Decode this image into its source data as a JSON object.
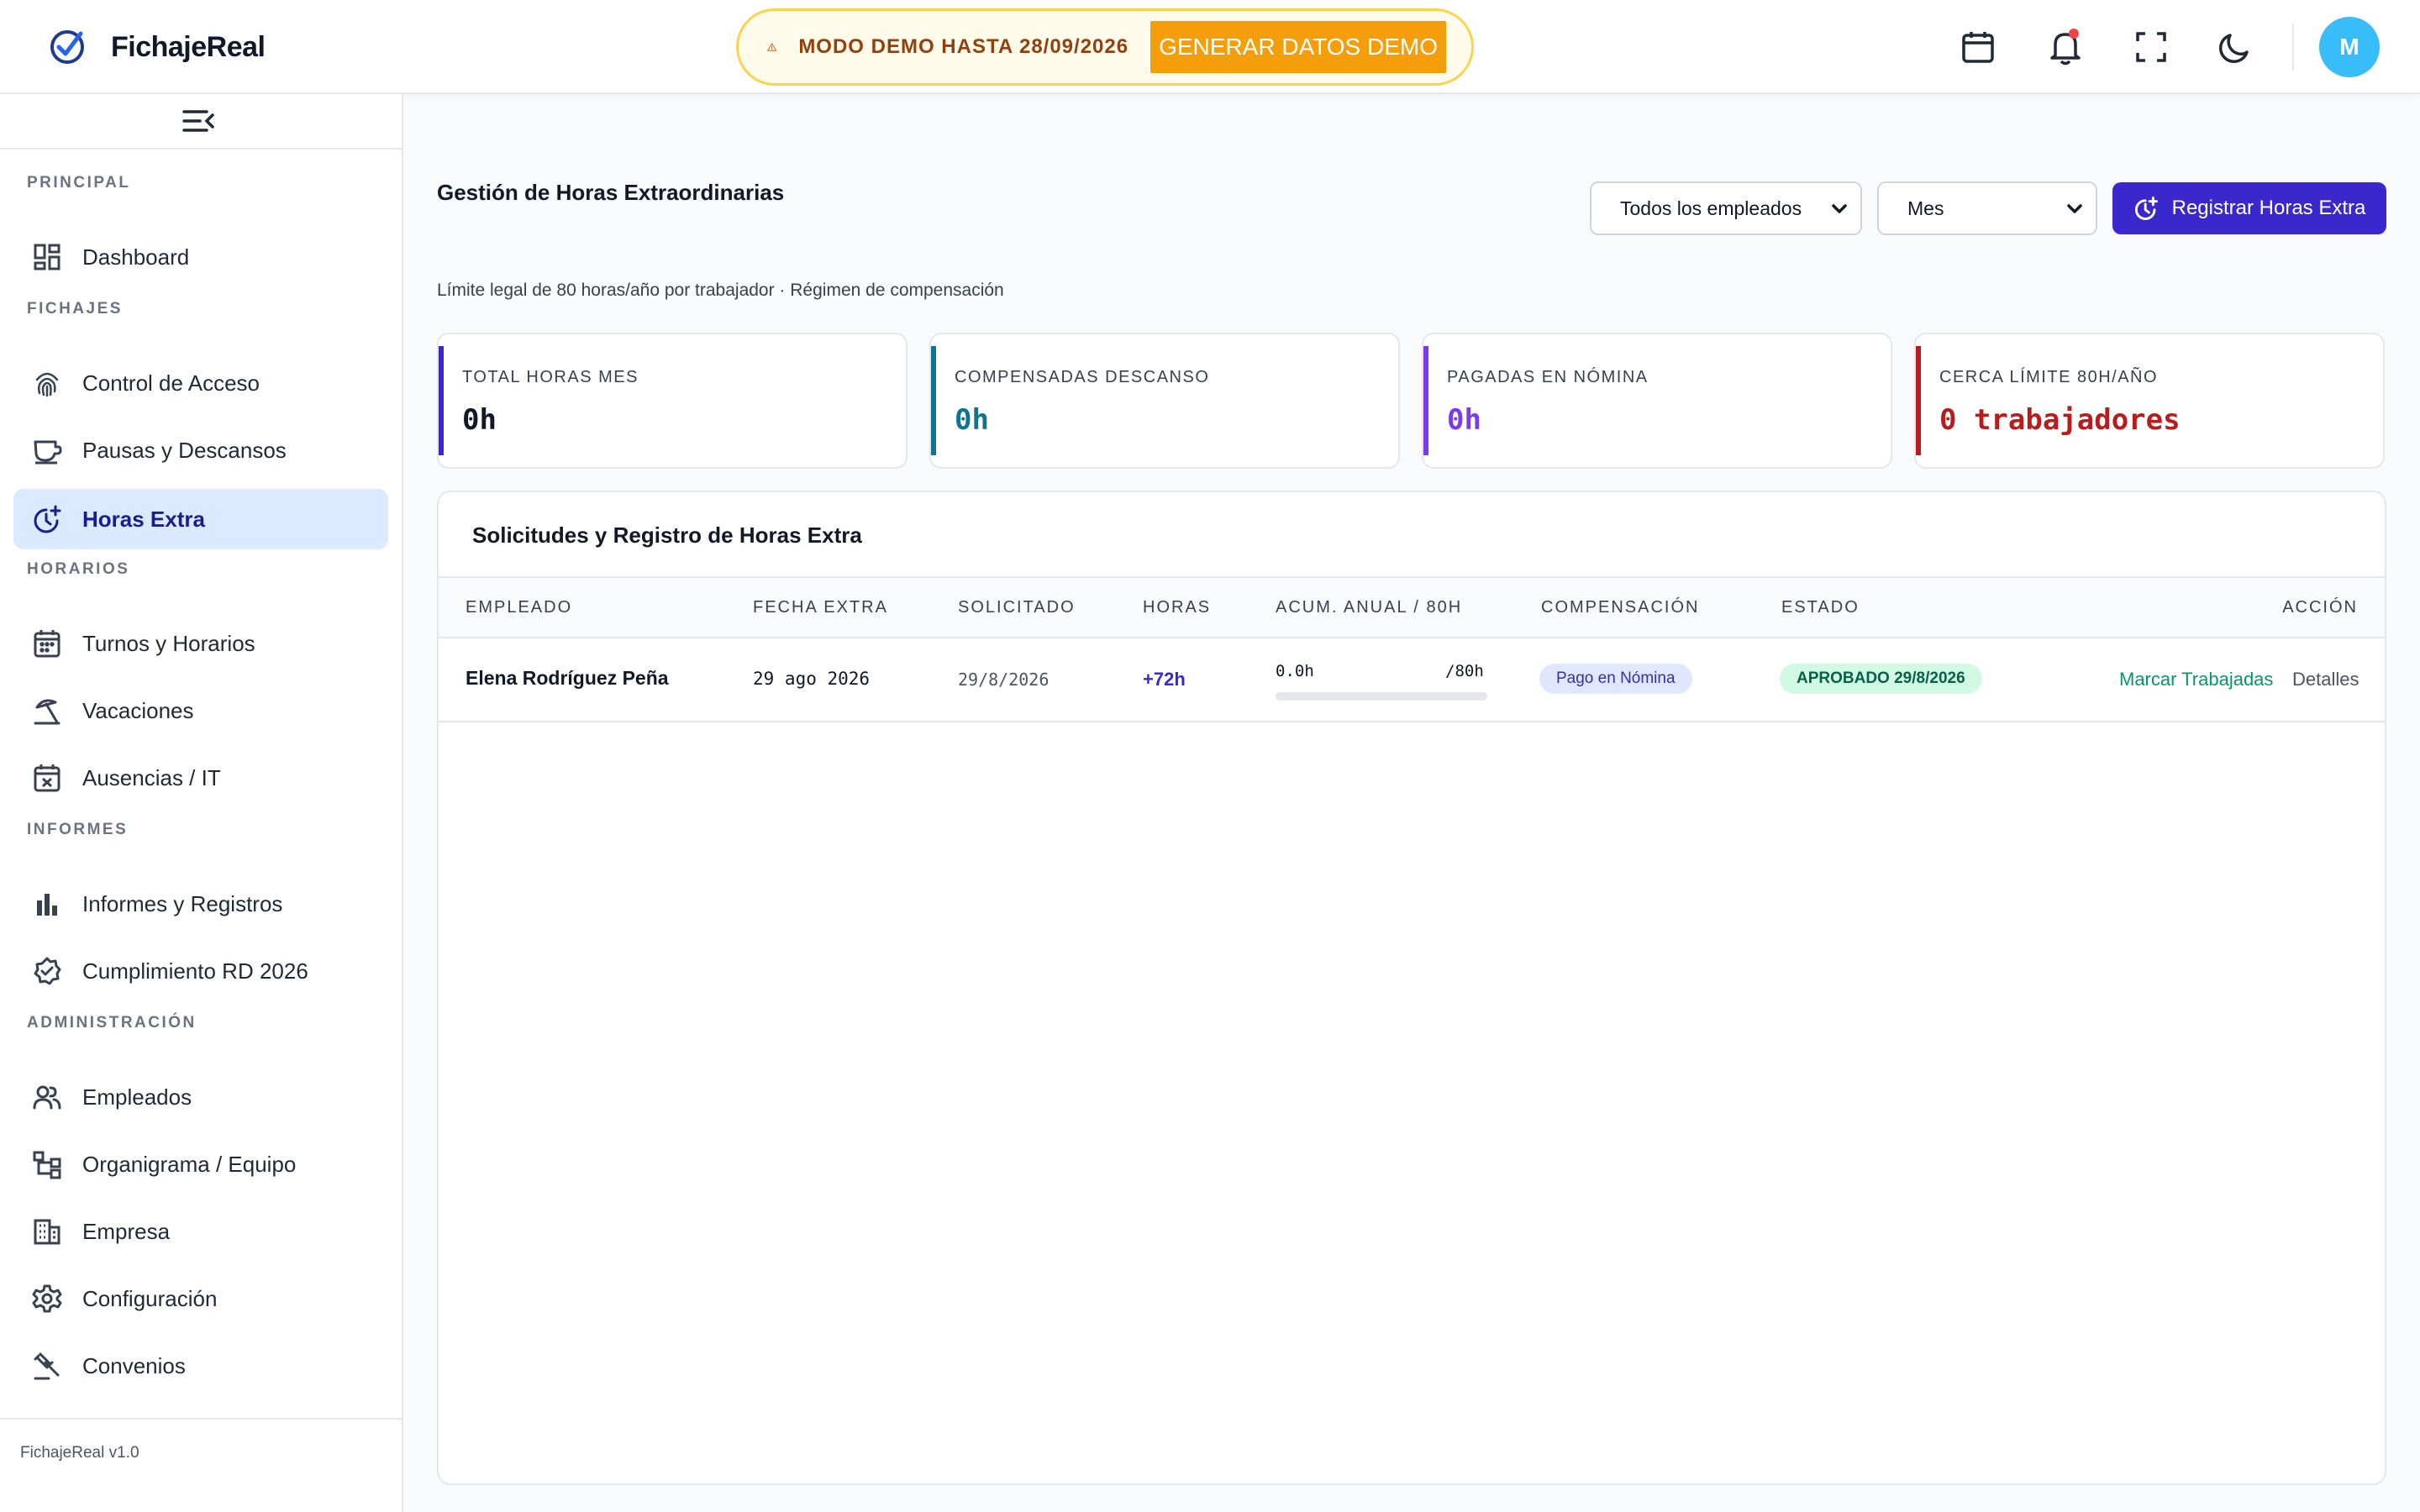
{
  "app": {
    "name": "FichajeReal",
    "version": "FichajeReal v1.0"
  },
  "banner": {
    "text": "MODO DEMO HASTA 28/09/2026",
    "button": "GENERAR DATOS DEMO"
  },
  "user": {
    "initial": "M"
  },
  "sidebar": {
    "sections": {
      "principal": "PRINCIPAL",
      "fichajes": "FICHAJES",
      "horarios": "HORARIOS",
      "informes": "INFORMES",
      "administracion": "ADMINISTRACIÓN"
    },
    "items": {
      "dashboard": "Dashboard",
      "control_acceso": "Control de Acceso",
      "pausas": "Pausas y Descansos",
      "horas_extra": "Horas Extra",
      "turnos": "Turnos y Horarios",
      "vacaciones": "Vacaciones",
      "ausencias": "Ausencias / IT",
      "informes": "Informes y Registros",
      "cumplimiento": "Cumplimiento RD 2026",
      "empleados": "Empleados",
      "organigrama": "Organigrama / Equipo",
      "empresa": "Empresa",
      "configuracion": "Configuración",
      "convenios": "Convenios"
    }
  },
  "page": {
    "title": "Gestión de Horas Extraordinarias",
    "subtitle": "Límite legal de 80 horas/año por trabajador · Régimen de compensación",
    "filters": {
      "employees": "Todos los empleados",
      "period": "Mes"
    },
    "primary_button": "Registrar Horas Extra"
  },
  "stats": [
    {
      "label": "TOTAL HORAS MES",
      "value": "0h",
      "color": "#111827",
      "accent": "#3b28cc"
    },
    {
      "label": "COMPENSADAS DESCANSO",
      "value": "0h",
      "color": "#0e7490",
      "accent": "#0e7490"
    },
    {
      "label": "PAGADAS EN NÓMINA",
      "value": "0h",
      "color": "#7c3aed",
      "accent": "#7c3aed"
    },
    {
      "label": "CERCA LÍMITE 80H/AÑO",
      "value": "0 trabajadores",
      "color": "#b91c1c",
      "accent": "#b91c1c"
    }
  ],
  "table": {
    "title": "Solicitudes y Registro de Horas Extra",
    "headers": [
      "EMPLEADO",
      "FECHA EXTRA",
      "SOLICITADO",
      "HORAS",
      "ACUM. ANUAL / 80H",
      "COMPENSACIÓN",
      "ESTADO",
      "ACCIÓN"
    ],
    "rows": [
      {
        "employee": "Elena Rodríguez Peña",
        "date": "29 ago 2026",
        "requested": "29/8/2026",
        "hours": "+72h",
        "acum": "0.0h",
        "acum_max": "/80h",
        "acum_fraction": 0,
        "compensation": "Pago en Nómina",
        "status": "APROBADO 29/8/2026",
        "action_primary": "Marcar Trabajadas",
        "action_secondary": "Detalles"
      }
    ]
  }
}
